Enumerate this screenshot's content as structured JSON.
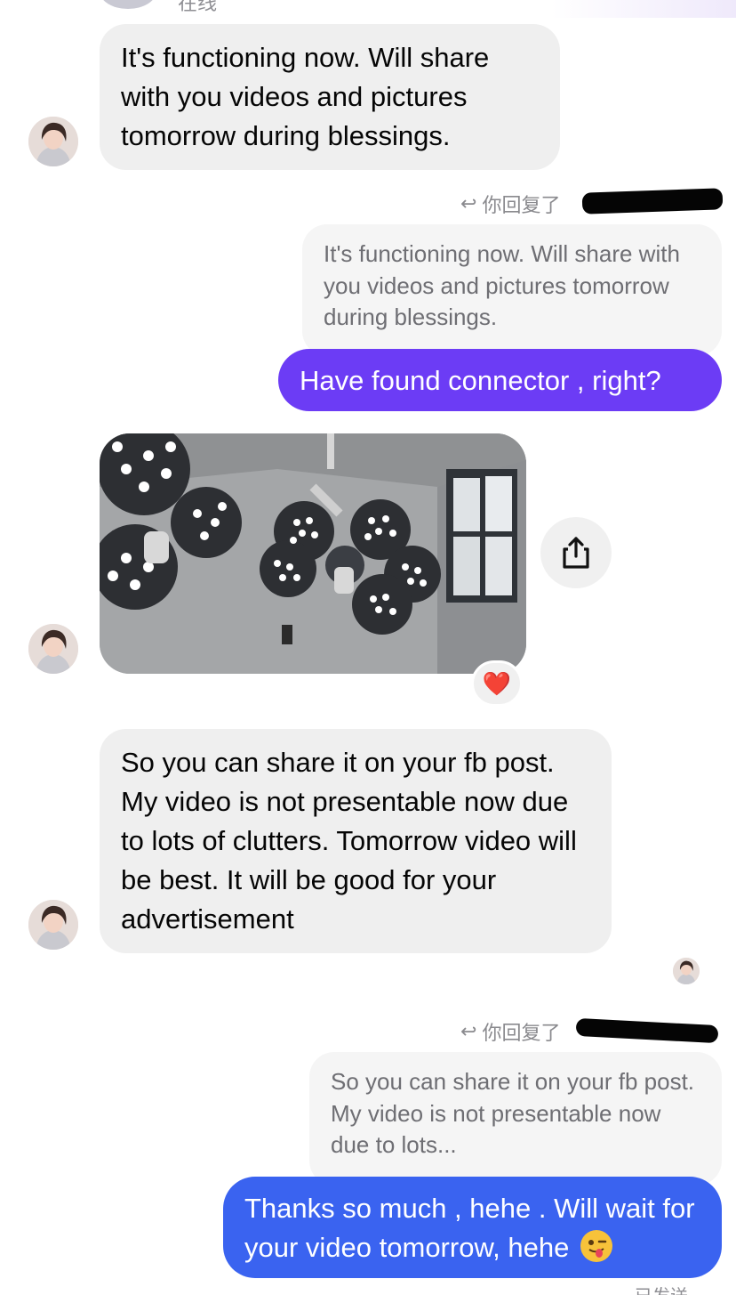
{
  "header": {
    "status_text": "在线"
  },
  "messages": [
    {
      "id": "m1",
      "direction": "incoming",
      "text": "It's functioning now. Will share with you videos and pictures tomorrow during blessings."
    },
    {
      "id": "m2",
      "direction": "outgoing",
      "reply_label": "你回复了",
      "quoted_text": "It's functioning now. Will share with you videos and pictures tomorrow during blessings.",
      "text": "Have found connector , right?",
      "bubble_color": "#6c3cf5"
    },
    {
      "id": "m3",
      "direction": "incoming",
      "type": "photo",
      "photo_description_icon": "surgical-light-photo",
      "reaction": "❤️"
    },
    {
      "id": "m4",
      "direction": "incoming",
      "text": "So you can share it on your fb post. My video is not presentable now due to lots of clutters. Tomorrow video will be best. It will be good for your advertisement"
    },
    {
      "id": "m5",
      "direction": "outgoing",
      "reply_label": "你回复了",
      "quoted_text": "So you can share it on your fb post. My video is not presentable now due to lots...",
      "text": "Thanks so much , hehe . Will wait for your video tomorrow, hehe",
      "emoji": "winking-face-with-tongue",
      "bubble_color": "#3a63f0"
    }
  ],
  "footer": {
    "delivery_status": "已发送"
  },
  "colors": {
    "incoming_bubble": "#efefef",
    "quote_bubble": "#f5f5f5",
    "purple_outgoing": "#6c3cf5",
    "blue_outgoing": "#3a63f0"
  }
}
